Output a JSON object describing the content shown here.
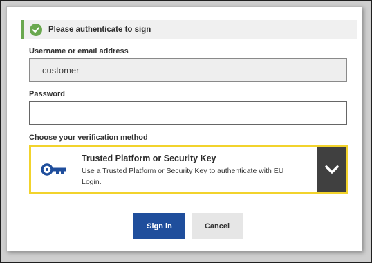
{
  "alert": {
    "icon": "check-circle-icon",
    "text": "Please authenticate to sign",
    "accent_color": "#6aa84f"
  },
  "username": {
    "label": "Username or email address",
    "value": "customer"
  },
  "password": {
    "label": "Password",
    "value": ""
  },
  "verification": {
    "label": "Choose your verification method",
    "selected": {
      "icon": "key-icon",
      "title": "Trusted Platform or Security Key",
      "description": "Use a Trusted Platform or Security Key to authenticate with EU Login."
    },
    "toggle_icon": "chevron-down-icon",
    "highlight_color": "#f2d32c"
  },
  "actions": {
    "sign_in_label": "Sign in",
    "cancel_label": "Cancel",
    "primary_color": "#1f4e9c"
  }
}
